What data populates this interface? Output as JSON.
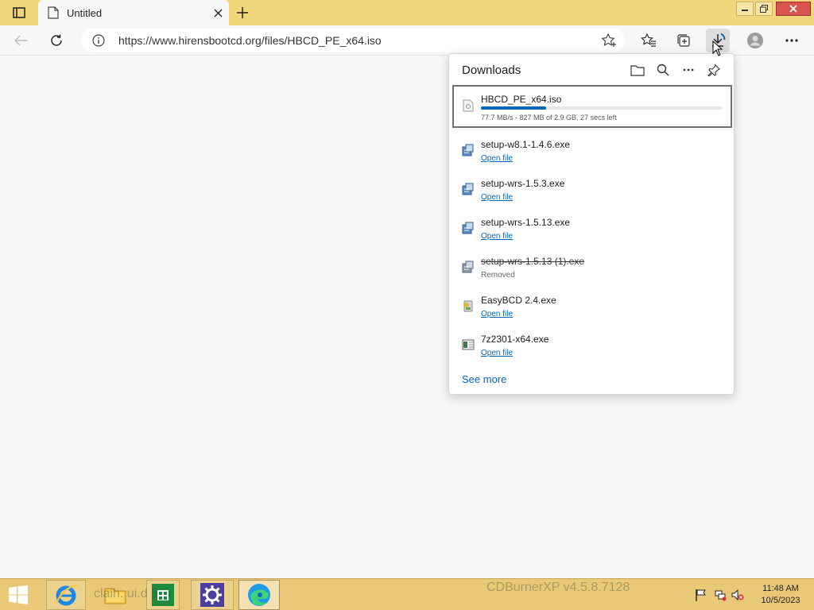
{
  "browser": {
    "tab": {
      "title": "Untitled"
    },
    "address": {
      "url": "https://www.hirensbootcd.org/files/HBCD_PE_x64.iso"
    }
  },
  "downloads": {
    "title": "Downloads",
    "items": [
      {
        "name": "HBCD_PE_x64.iso",
        "status": "77.7 MB/s - 827 MB of 2.9 GB, 27 secs left",
        "progress": 0.27,
        "icon": "file-iso-icon"
      },
      {
        "name": "setup-w8.1-1.4.6.exe",
        "action": "Open file",
        "icon": "installer-icon"
      },
      {
        "name": "setup-wrs-1.5.3.exe",
        "action": "Open file",
        "icon": "installer-icon"
      },
      {
        "name": "setup-wrs-1.5.13.exe",
        "action": "Open file",
        "icon": "installer-icon"
      },
      {
        "name": "setup-wrs-1.5.13 (1).exe",
        "status": "Removed",
        "icon": "installer-icon"
      },
      {
        "name": "EasyBCD 2.4.exe",
        "action": "Open file",
        "icon": "easybcd-icon"
      },
      {
        "name": "7z2301-x64.exe",
        "action": "Open file",
        "icon": "7zip-icon"
      }
    ],
    "see_more": "See more"
  },
  "taskbar": {
    "ghost_text_1": "claih.  ui.d    5",
    "ghost_text_2": "CDBurnerXP v4.5.8.7128",
    "clock": {
      "time": "11:48 AM",
      "date": "10/5/2023"
    }
  },
  "colors": {
    "titlebar": "#f3d67b",
    "taskbar": "#e9c977",
    "accent": "#0067b8"
  }
}
